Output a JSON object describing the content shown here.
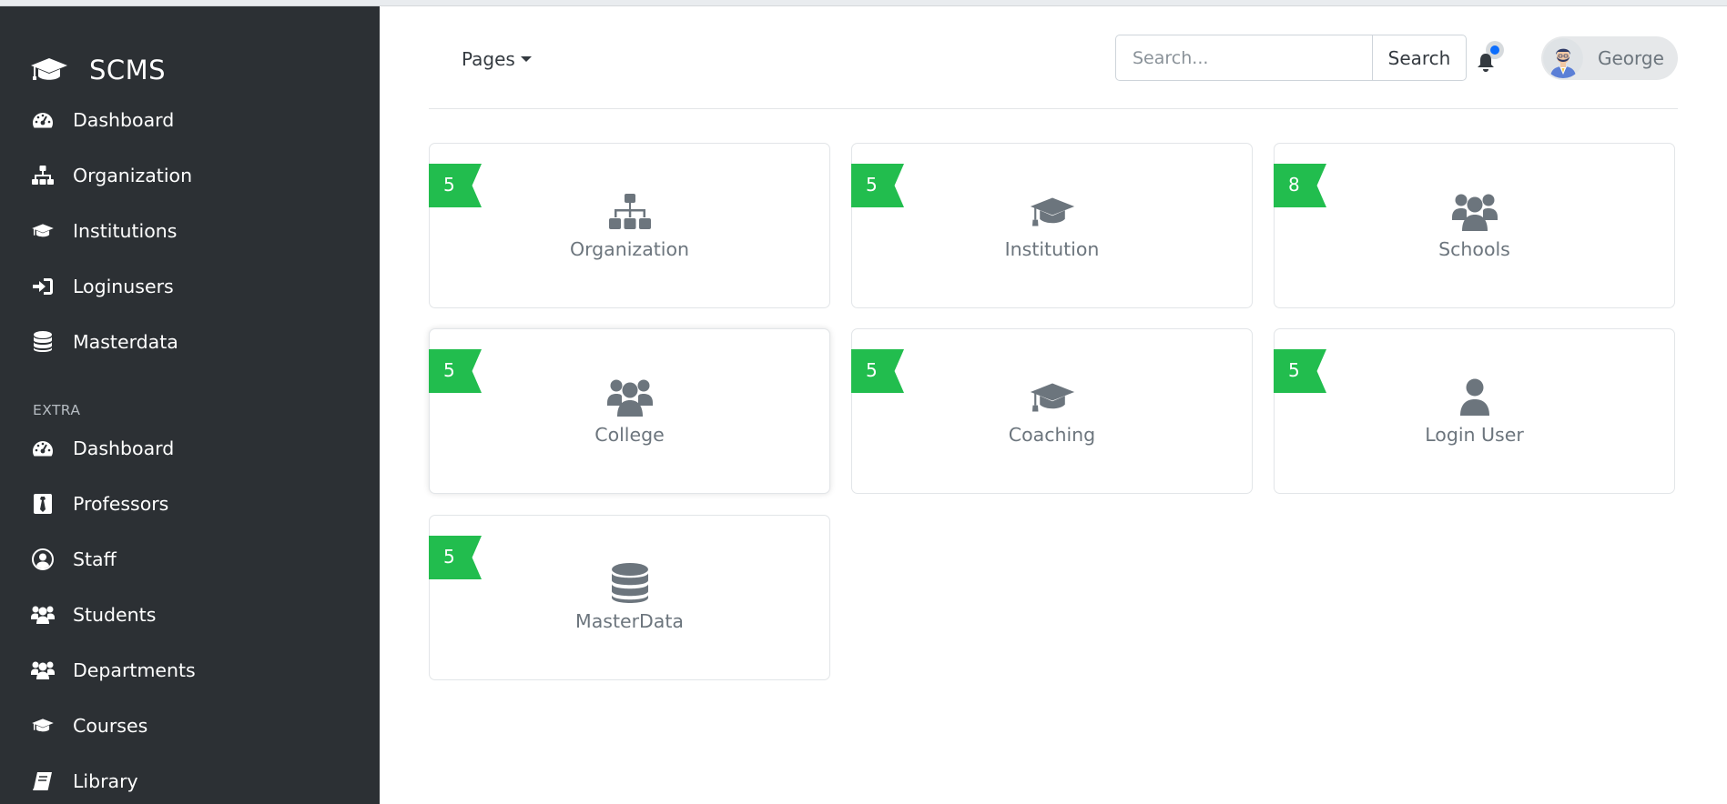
{
  "brand": {
    "name": "SCMS",
    "icon": "graduation-cap-icon"
  },
  "sidebar": {
    "main_items": [
      {
        "label": "Dashboard",
        "icon": "tachometer-icon"
      },
      {
        "label": "Organization",
        "icon": "sitemap-icon"
      },
      {
        "label": "Institutions",
        "icon": "graduation-cap-icon"
      },
      {
        "label": "Loginusers",
        "icon": "sign-in-icon"
      },
      {
        "label": "Masterdata",
        "icon": "database-icon"
      }
    ],
    "extra_heading": "EXTRA",
    "extra_items": [
      {
        "label": "Dashboard",
        "icon": "tachometer-icon"
      },
      {
        "label": "Professors",
        "icon": "id-badge-icon"
      },
      {
        "label": "Staff",
        "icon": "user-circle-icon"
      },
      {
        "label": "Students",
        "icon": "users-icon"
      },
      {
        "label": "Departments",
        "icon": "users-icon"
      },
      {
        "label": "Courses",
        "icon": "graduation-cap-icon"
      },
      {
        "label": "Library",
        "icon": "book-icon"
      }
    ]
  },
  "header": {
    "pages_label": "Pages",
    "search_placeholder": "Search...",
    "search_button": "Search",
    "notification_icon": "bell-icon",
    "user_name": "George"
  },
  "cards": [
    {
      "count": "5",
      "label": "Organization",
      "icon": "sitemap-icon"
    },
    {
      "count": "5",
      "label": "Institution",
      "icon": "graduation-cap-icon"
    },
    {
      "count": "8",
      "label": "Schools",
      "icon": "users-icon"
    },
    {
      "count": "5",
      "label": "College",
      "icon": "users-icon"
    },
    {
      "count": "5",
      "label": "Coaching",
      "icon": "graduation-cap-icon"
    },
    {
      "count": "5",
      "label": "Login User",
      "icon": "user-icon"
    },
    {
      "count": "5",
      "label": "MasterData",
      "icon": "database-icon"
    }
  ],
  "colors": {
    "sidebar_bg": "#2c3034",
    "ribbon": "#22bd4e",
    "card_icon": "#6c757d",
    "notification_dot": "#0d6efd"
  }
}
